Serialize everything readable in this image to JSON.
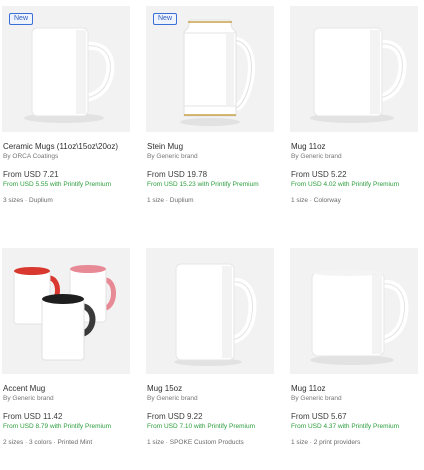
{
  "products": [
    {
      "badge": "New",
      "title": "Ceramic Mugs (11oz\\15oz\\20oz)",
      "brand": "By ORCA Coatings",
      "price": "From USD 7.21",
      "premium": "From USD 5.55 with Printify Premium",
      "meta": "3 sizes · Duplium"
    },
    {
      "badge": "New",
      "title": "Stein Mug",
      "brand": "By Generic brand",
      "price": "From USD 19.78",
      "premium": "From USD 15.23 with Printify Premium",
      "meta": "1 size · Duplium"
    },
    {
      "badge": "",
      "title": "Mug 11oz",
      "brand": "By Generic brand",
      "price": "From USD 5.22",
      "premium": "From USD 4.02 with Printify Premium",
      "meta": "1 size · Colorway"
    },
    {
      "badge": "",
      "title": "Accent Mug",
      "brand": "By Generic brand",
      "price": "From USD 11.42",
      "premium": "From USD 8.79 with Printify Premium",
      "meta": "2 sizes · 3 colors · Printed Mint"
    },
    {
      "badge": "",
      "title": "Mug 15oz",
      "brand": "By Generic brand",
      "price": "From USD 9.22",
      "premium": "From USD 7.10 with Printify Premium",
      "meta": "1 size · SPOKE Custom Products"
    },
    {
      "badge": "",
      "title": "Mug 11oz",
      "brand": "By Generic brand",
      "price": "From USD 5.67",
      "premium": "From USD 4.37 with Printify Premium",
      "meta": "1 size · 2 print providers"
    }
  ],
  "colors": {
    "premium_green": "#2a9d3c",
    "badge_blue": "#2e5fc2",
    "thumb_bg": "#f2f2f2"
  }
}
